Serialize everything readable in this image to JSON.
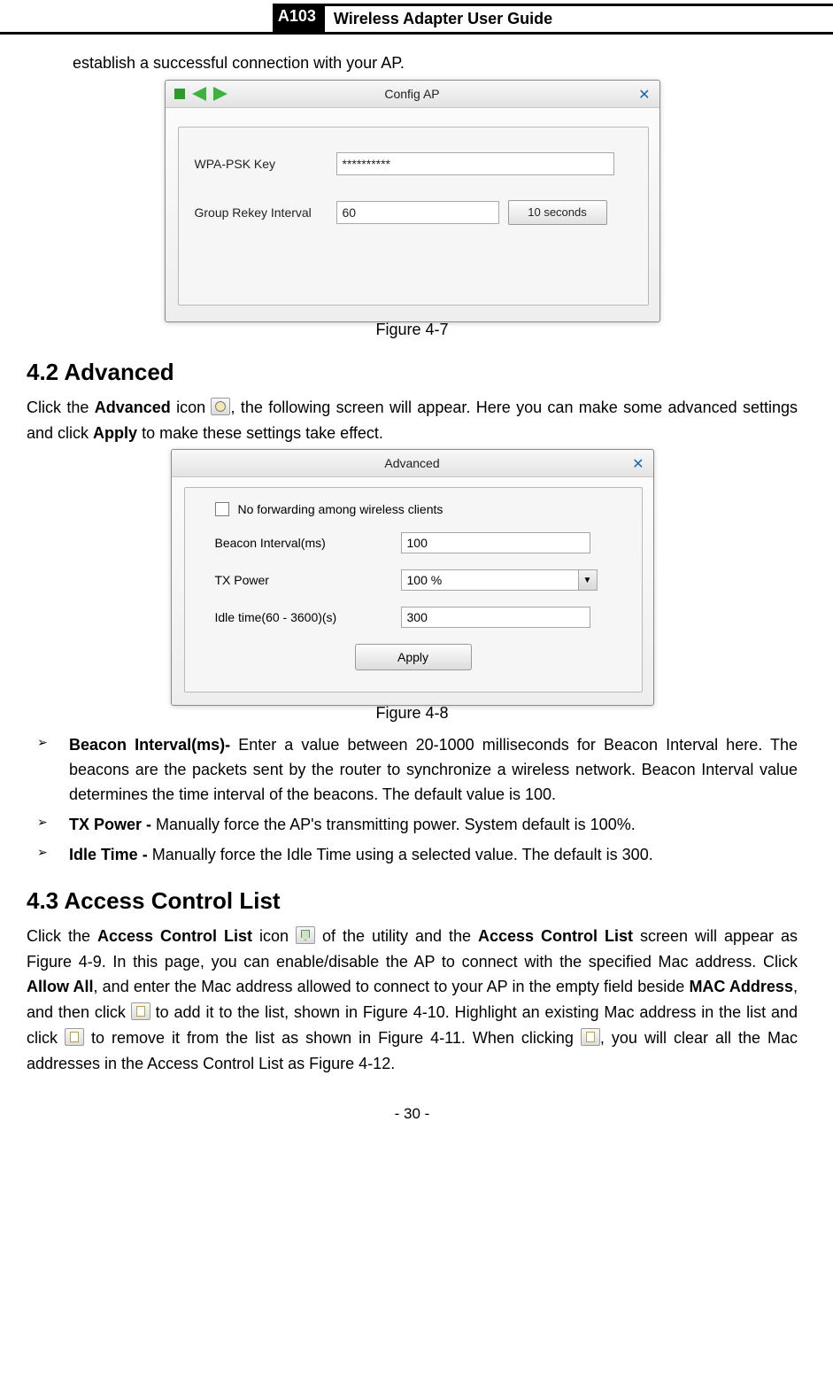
{
  "header": {
    "model": "A103",
    "title": "Wireless Adapter User Guide"
  },
  "intro_line": "establish a successful connection with your AP.",
  "config_ap": {
    "title": "Config AP",
    "row1_label": "WPA-PSK Key",
    "row1_value": "**********",
    "row2_label": "Group Rekey Interval",
    "row2_value": "60",
    "row2_button": "10 seconds",
    "caption": "Figure 4-7"
  },
  "section42": {
    "heading": "4.2    Advanced",
    "para_a": "Click the ",
    "para_b": "Advanced",
    "para_c": " icon ",
    "para_d": ", the following screen will appear. Here you can make some advanced settings and click ",
    "para_e": "Apply",
    "para_f": " to make these settings take effect."
  },
  "advanced": {
    "title": "Advanced",
    "checkbox_label": "No forwarding among wireless clients",
    "row1_label": "Beacon Interval(ms)",
    "row1_value": "100",
    "row2_label": "TX Power",
    "row2_value": "100 %",
    "row3_label": "Idle time(60 - 3600)(s)",
    "row3_value": "300",
    "apply": "Apply",
    "caption": "Figure 4-8"
  },
  "bullets": {
    "b1_a": "Beacon Interval(ms)- ",
    "b1_b": "Enter a value between 20-1000 milliseconds for Beacon Interval here. The beacons are the packets sent by the router to synchronize a wireless network. Beacon Interval value determines the time interval of the beacons. The default value is 100.",
    "b2_a": "TX Power - ",
    "b2_b": "Manually force the AP's transmitting power. System default is 100%.",
    "b3_a": "Idle Time - ",
    "b3_b": "Manually force the Idle Time using a selected value. The default is 300."
  },
  "section43": {
    "heading": "4.3  Access Control List",
    "p1": "Click the ",
    "p2": "Access Control List",
    "p3": " icon ",
    "p4": " of the utility and the ",
    "p5": "Access Control List",
    "p6": " screen will appear as Figure 4-9. In this page, you can enable/disable the AP to connect with the specified Mac address. Click ",
    "p7": "Allow All",
    "p8": ", and enter the Mac address allowed to connect to your AP in the empty field beside ",
    "p9": "MAC Address",
    "p10": ", and then click ",
    "p11": " to add it to the list, shown in Figure 4-10. Highlight an existing Mac address in the list and click ",
    "p12": " to remove it from the list as shown in Figure 4-11. When clicking ",
    "p13": ", you will clear all the Mac addresses in the Access Control List as Figure 4-12."
  },
  "footer": "- 30 -"
}
